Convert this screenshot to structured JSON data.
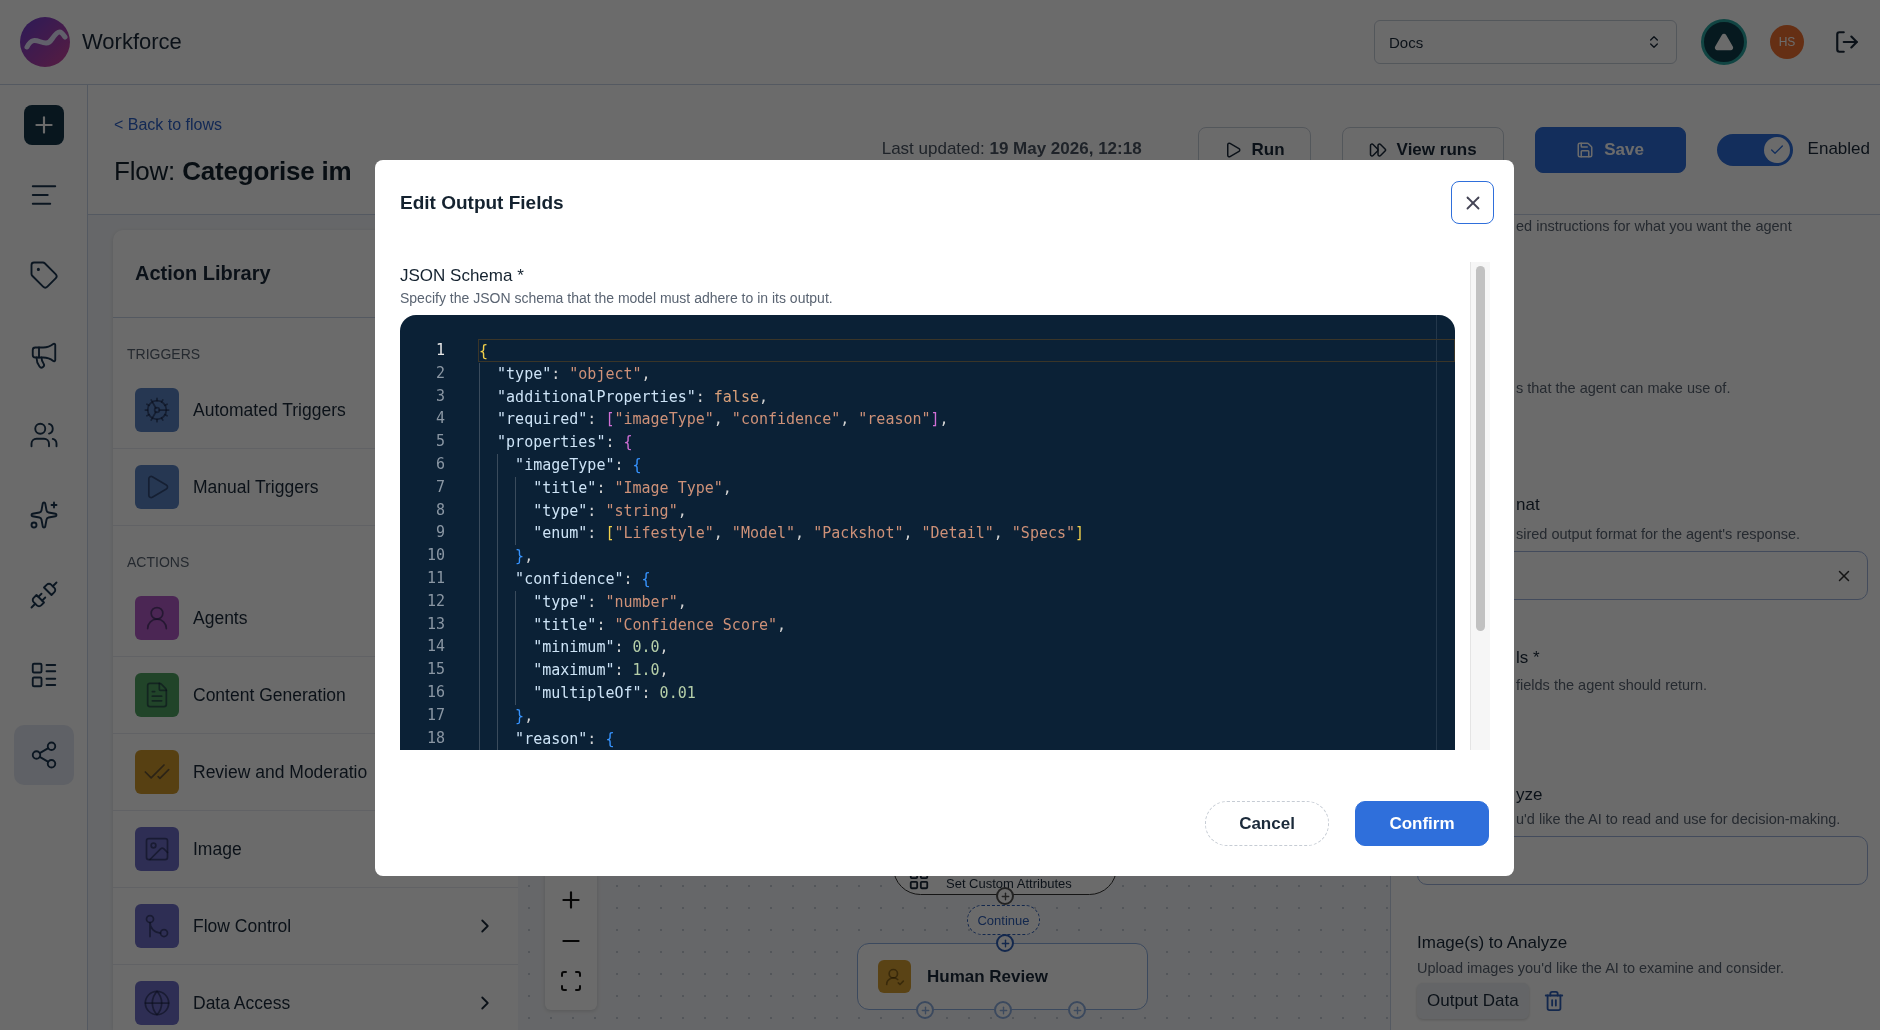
{
  "top_bar": {
    "app_name": "Workforce",
    "workspace_select": {
      "value": "Docs"
    },
    "user_avatar": {
      "initials": "HS"
    }
  },
  "rail": {
    "items": [
      {
        "selected": false
      },
      {
        "selected": false
      },
      {
        "selected": false
      },
      {
        "selected": false
      },
      {
        "selected": false
      },
      {
        "selected": false
      },
      {
        "selected": false
      },
      {
        "selected": true
      }
    ]
  },
  "header": {
    "back_link": "< Back to flows",
    "title": "Flow: **Categorise im**",
    "last_updated": "Last updated: **19 May 2026, 12:18**",
    "buttons": [
      {
        "label": "Run",
        "kind": "run"
      },
      {
        "label": "View runs",
        "kind": "runs"
      },
      {
        "label": "Save",
        "kind": "save"
      }
    ],
    "toggle": {
      "label": "Enabled",
      "on": true
    }
  },
  "action_library": {
    "title": "Action Library",
    "sections": [
      {
        "label": "TRIGGERS",
        "items": [
          {
            "label": "Automated Triggers",
            "kind": "action"
          },
          {
            "label": "Manual Triggers",
            "kind": "action"
          }
        ]
      },
      {
        "label": "ACTIONS",
        "items": [
          {
            "label": "Agents",
            "kind": "action"
          },
          {
            "label": "Content Generation",
            "kind": "action"
          },
          {
            "label": "Review and Moderatio",
            "kind": "action"
          },
          {
            "label": "Image",
            "kind": "action"
          },
          {
            "label": "Flow Control",
            "kind": "submenu"
          },
          {
            "label": "Data Access",
            "kind": "submenu"
          }
        ]
      }
    ]
  },
  "canvas": {
    "upper_node": {
      "label": "Set Custom Attributes"
    },
    "branch_label": "Continue",
    "lower_node": {
      "label": "Human Review"
    }
  },
  "right_panel": {
    "partial": [
      {
        "kind": "text",
        "text": "ed instructions for what you want the agent"
      },
      {
        "kind": "text",
        "text": "s that the agent can make use of."
      },
      {
        "kind": "heading",
        "text": "nat"
      },
      {
        "kind": "text",
        "text": "sired output format for the agent's response."
      },
      {
        "kind": "field",
        "clearable": true
      },
      {
        "kind": "heading",
        "text": "ls *"
      },
      {
        "kind": "text",
        "text": "fields the agent should return."
      },
      {
        "kind": "heading",
        "text": "yze"
      },
      {
        "kind": "text",
        "text": "u'd like the AI to read and use for decision-making."
      },
      {
        "kind": "field",
        "clearable": false
      }
    ],
    "images_section": {
      "title": "Image(s) to Analyze",
      "description": "Upload images you'd like the AI to examine and consider.",
      "chip": "Output Data"
    }
  },
  "modal": {
    "title": "Edit Output Fields",
    "field_label": "JSON Schema *",
    "field_description": "Specify the JSON schema that the model must adhere to in its output.",
    "code": {
      "lines": [
        {
          "number": "1",
          "active": true,
          "tokens": [
            {
              "kind": "bracket",
              "text": "{",
              "color": "#f1d04b"
            }
          ]
        },
        {
          "number": "2",
          "active": false,
          "tokens": [
            {
              "kind": "key",
              "text": "  \"type\""
            },
            {
              "kind": "punct",
              "text": ": "
            },
            {
              "kind": "string",
              "text": "\"object\""
            },
            {
              "kind": "punct",
              "text": ","
            }
          ]
        },
        {
          "number": "3",
          "active": false,
          "tokens": [
            {
              "kind": "key",
              "text": "  \"additionalProperties\""
            },
            {
              "kind": "punct",
              "text": ": "
            },
            {
              "kind": "keyword",
              "text": "false"
            },
            {
              "kind": "punct",
              "text": ","
            }
          ]
        },
        {
          "number": "4",
          "active": false,
          "tokens": [
            {
              "kind": "key",
              "text": "  \"required\""
            },
            {
              "kind": "punct",
              "text": ": "
            },
            {
              "kind": "bracket",
              "text": "[",
              "color": "#d16fd6"
            },
            {
              "kind": "string",
              "text": "\"imageType\""
            },
            {
              "kind": "punct",
              "text": ", "
            },
            {
              "kind": "string",
              "text": "\"confidence\""
            },
            {
              "kind": "punct",
              "text": ", "
            },
            {
              "kind": "string",
              "text": "\"reason\""
            },
            {
              "kind": "bracket",
              "text": "]",
              "color": "#d16fd6"
            },
            {
              "kind": "punct",
              "text": ","
            }
          ]
        },
        {
          "number": "5",
          "active": false,
          "tokens": [
            {
              "kind": "key",
              "text": "  \"properties\""
            },
            {
              "kind": "punct",
              "text": ": "
            },
            {
              "kind": "bracket",
              "text": "{",
              "color": "#d16fd6"
            }
          ]
        },
        {
          "number": "6",
          "active": false,
          "tokens": [
            {
              "kind": "key",
              "text": "    \"imageType\""
            },
            {
              "kind": "punct",
              "text": ": "
            },
            {
              "kind": "bracket",
              "text": "{",
              "color": "#3794ff"
            }
          ]
        },
        {
          "number": "7",
          "active": false,
          "tokens": [
            {
              "kind": "key",
              "text": "      \"title\""
            },
            {
              "kind": "punct",
              "text": ": "
            },
            {
              "kind": "string",
              "text": "\"Image Type\""
            },
            {
              "kind": "punct",
              "text": ","
            }
          ]
        },
        {
          "number": "8",
          "active": false,
          "tokens": [
            {
              "kind": "key",
              "text": "      \"type\""
            },
            {
              "kind": "punct",
              "text": ": "
            },
            {
              "kind": "string",
              "text": "\"string\""
            },
            {
              "kind": "punct",
              "text": ","
            }
          ]
        },
        {
          "number": "9",
          "active": false,
          "tokens": [
            {
              "kind": "key",
              "text": "      \"enum\""
            },
            {
              "kind": "punct",
              "text": ": "
            },
            {
              "kind": "bracket",
              "text": "[",
              "color": "#f1d04b"
            },
            {
              "kind": "string",
              "text": "\"Lifestyle\""
            },
            {
              "kind": "punct",
              "text": ", "
            },
            {
              "kind": "string",
              "text": "\"Model\""
            },
            {
              "kind": "punct",
              "text": ", "
            },
            {
              "kind": "string",
              "text": "\"Packshot\""
            },
            {
              "kind": "punct",
              "text": ", "
            },
            {
              "kind": "string",
              "text": "\"Detail\""
            },
            {
              "kind": "punct",
              "text": ", "
            },
            {
              "kind": "string",
              "text": "\"Specs\""
            },
            {
              "kind": "bracket",
              "text": "]",
              "color": "#f1d04b"
            }
          ]
        },
        {
          "number": "10",
          "active": false,
          "tokens": [
            {
              "kind": "bracket",
              "text": "    }",
              "color": "#3794ff"
            },
            {
              "kind": "punct",
              "text": ","
            }
          ]
        },
        {
          "number": "11",
          "active": false,
          "tokens": [
            {
              "kind": "key",
              "text": "    \"confidence\""
            },
            {
              "kind": "punct",
              "text": ": "
            },
            {
              "kind": "bracket",
              "text": "{",
              "color": "#3794ff"
            }
          ]
        },
        {
          "number": "12",
          "active": false,
          "tokens": [
            {
              "kind": "key",
              "text": "      \"type\""
            },
            {
              "kind": "punct",
              "text": ": "
            },
            {
              "kind": "string",
              "text": "\"number\""
            },
            {
              "kind": "punct",
              "text": ","
            }
          ]
        },
        {
          "number": "13",
          "active": false,
          "tokens": [
            {
              "kind": "key",
              "text": "      \"title\""
            },
            {
              "kind": "punct",
              "text": ": "
            },
            {
              "kind": "string",
              "text": "\"Confidence Score\""
            },
            {
              "kind": "punct",
              "text": ","
            }
          ]
        },
        {
          "number": "14",
          "active": false,
          "tokens": [
            {
              "kind": "key",
              "text": "      \"minimum\""
            },
            {
              "kind": "punct",
              "text": ": "
            },
            {
              "kind": "number",
              "text": "0.0"
            },
            {
              "kind": "punct",
              "text": ","
            }
          ]
        },
        {
          "number": "15",
          "active": false,
          "tokens": [
            {
              "kind": "key",
              "text": "      \"maximum\""
            },
            {
              "kind": "punct",
              "text": ": "
            },
            {
              "kind": "number",
              "text": "1.0"
            },
            {
              "kind": "punct",
              "text": ","
            }
          ]
        },
        {
          "number": "16",
          "active": false,
          "tokens": [
            {
              "kind": "key",
              "text": "      \"multipleOf\""
            },
            {
              "kind": "punct",
              "text": ": "
            },
            {
              "kind": "number",
              "text": "0.01"
            }
          ]
        },
        {
          "number": "17",
          "active": false,
          "tokens": [
            {
              "kind": "bracket",
              "text": "    }",
              "color": "#3794ff"
            },
            {
              "kind": "punct",
              "text": ","
            }
          ]
        },
        {
          "number": "18",
          "active": false,
          "tokens": [
            {
              "kind": "key",
              "text": "    \"reason\""
            },
            {
              "kind": "punct",
              "text": ": "
            },
            {
              "kind": "bracket",
              "text": "{",
              "color": "#3794ff"
            }
          ]
        }
      ]
    },
    "buttons": [
      {
        "label": "Cancel",
        "kind": "secondary"
      },
      {
        "label": "Confirm",
        "kind": "primary"
      }
    ]
  }
}
